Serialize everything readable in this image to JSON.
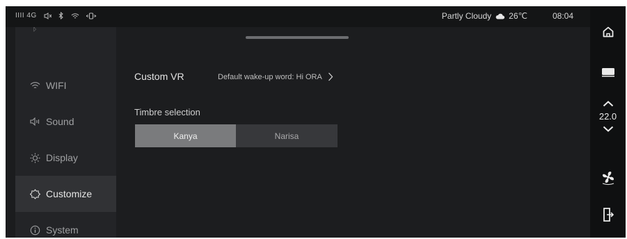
{
  "status": {
    "signal": "IIII 4G",
    "weather": "Partly Cloudy",
    "temperature": "26℃",
    "time": "08:04"
  },
  "sidebar": {
    "items": [
      {
        "label": "WIFI",
        "icon": "wifi-icon",
        "active": false
      },
      {
        "label": "Sound",
        "icon": "speaker-icon",
        "active": false
      },
      {
        "label": "Display",
        "icon": "brightness-icon",
        "active": false
      },
      {
        "label": "Customize",
        "icon": "customize-icon",
        "active": true
      },
      {
        "label": "System",
        "icon": "info-icon",
        "active": false
      }
    ]
  },
  "main": {
    "custom_vr": {
      "title": "Custom VR",
      "value": "Default wake-up word: Hi ORA"
    },
    "timbre": {
      "title": "Timbre selection",
      "options": [
        "Kanya",
        "Narisa"
      ],
      "selected": "Kanya"
    }
  },
  "rail": {
    "temperature": "22.0"
  },
  "colors": {
    "background": "#1b1c1e",
    "sidebar": "#232427",
    "active_item": "#313235",
    "segment_selected": "#7a7b7d",
    "segment_unselected": "#37383b"
  }
}
